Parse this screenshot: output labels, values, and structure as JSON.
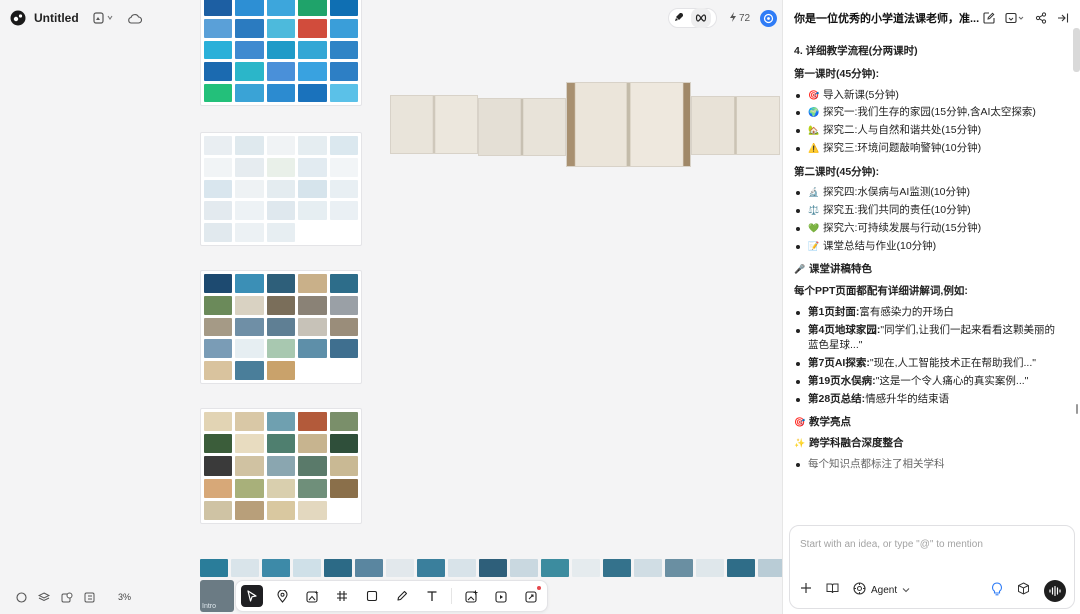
{
  "app": {
    "title": "Untitled"
  },
  "top": {
    "credits": "72",
    "avatar_initial": ""
  },
  "canvas": {
    "zoom": "3%",
    "thumb_caption": "Intro"
  },
  "colors": {
    "board1": [
      "#1d5fa3",
      "#2d8fd4",
      "#3da6dc",
      "#1fa36a",
      "#0f6fb3",
      "#5aa0d8",
      "#2b7bc0",
      "#4dbadc",
      "#d14c3c",
      "#3a9ed9",
      "#2bb0d9",
      "#3f8ad0",
      "#1f9bc8",
      "#34a7d5",
      "#2f84c6",
      "#1b6ab0",
      "#2bb6c9",
      "#4a90d9",
      "#39a2e0",
      "#2d7fc5",
      "#23c07a",
      "#3aa3d6",
      "#2c8bd0",
      "#1a72bc",
      "#5bc1e8"
    ],
    "board2": [
      "#e9eef2",
      "#dfe9ee",
      "#f0f3f5",
      "#e5edf1",
      "#dbe8ef",
      "#f1f4f6",
      "#e6ecf0",
      "#e9f0e9",
      "#e2ebf1",
      "#f2f5f7",
      "#d9e6ee",
      "#eef2f4",
      "#e4ecf0",
      "#d6e4ec",
      "#e8eff3",
      "#e3eaef",
      "#edf2f5",
      "#dfe8ee",
      "#e6eef2",
      "#eaf0f4",
      "#e1e9ee",
      "#ecf1f4",
      "#e7eef2",
      "#ffffff",
      "#ffffff"
    ],
    "board3": [
      "#1d4a70",
      "#3b8fb6",
      "#2e5f7a",
      "#c9b089",
      "#2d6d8a",
      "#6b8a5a",
      "#d9d2c2",
      "#7a6e5a",
      "#8a8276",
      "#9aa0a6",
      "#a59a86",
      "#6f8fa6",
      "#5f7f94",
      "#c7c2b8",
      "#9a8d7a",
      "#7a9cb6",
      "#e6eef2",
      "#a8c8b0",
      "#5e8fa9",
      "#3f6f8f",
      "#d9c39e",
      "#4a7e9a",
      "#c9a26b",
      "#ffffff",
      "#ffffff"
    ],
    "board4": [
      "#e2d4b4",
      "#d9c8a6",
      "#6fa0b0",
      "#b35a3a",
      "#7a8f6a",
      "#3b5d3a",
      "#e8dcc0",
      "#4f7f6f",
      "#c7b48f",
      "#2f4f3a",
      "#3a3a3a",
      "#d0c2a2",
      "#8aa6b0",
      "#5a7a6a",
      "#c9b994",
      "#d7a878",
      "#a8b07a",
      "#d9cfae",
      "#6f8f7a",
      "#8a6f4a",
      "#cfc3a4",
      "#b89f7a",
      "#d9c8a0",
      "#e3d8bf",
      "#ffffff"
    ],
    "strip": [
      "#2a7d9a",
      "#d9e4ea",
      "#3d8aa8",
      "#cfe0e8",
      "#2c6a86",
      "#5a86a0",
      "#e2e8ec",
      "#3a7f9c",
      "#d8e3e9",
      "#2e5f7a",
      "#c9d8e0",
      "#3c8c9f",
      "#e5ebee",
      "#34728c",
      "#d0dde4",
      "#6a8fa2",
      "#dfe7eb",
      "#2f6d88",
      "#b9ccd6",
      "#4c8aa6",
      "#dde5ea",
      "#36809c",
      "#cfdde4",
      "#5a7f93",
      "#2a6f8c",
      "#e3e9ec"
    ]
  },
  "panel": {
    "title": "你是一位优秀的小学道法课老师，准...",
    "section_flow": "4. 详细教学流程(分两课时)",
    "lesson1_title": "第一课时(45分钟):",
    "lesson1_items": [
      {
        "icon": "🎯",
        "text": "导入新课(5分钟)"
      },
      {
        "icon": "🌍",
        "text": "探究一:我们生存的家园(15分钟,含AI太空探索)"
      },
      {
        "icon": "🏡",
        "text": "探究二:人与自然和谐共处(15分钟)"
      },
      {
        "icon": "⚠️",
        "text": "探究三:环境问题敲响警钟(10分钟)"
      }
    ],
    "lesson2_title": "第二课时(45分钟):",
    "lesson2_items": [
      {
        "icon": "🔬",
        "text": "探究四:水俣病与AI监测(10分钟)"
      },
      {
        "icon": "⚖️",
        "text": "探究五:我们共同的责任(10分钟)"
      },
      {
        "icon": "💚",
        "text": "探究六:可持续发展与行动(15分钟)"
      },
      {
        "icon": "📝",
        "text": "课堂总结与作业(10分钟)"
      }
    ],
    "speech_icon": "🎤",
    "speech_title": "课堂讲稿特色",
    "speech_intro": "每个PPT页面都配有详细讲解词,例如:",
    "speech_items": [
      {
        "label": "第1页封面:",
        "text": "富有感染力的开场白"
      },
      {
        "label": "第4页地球家园:",
        "text": "\"同学们,让我们一起来看看这颗美丽的蓝色星球...\""
      },
      {
        "label": "第7页AI探索:",
        "text": "\"现在,人工智能技术正在帮助我们...\""
      },
      {
        "label": "第19页水俣病:",
        "text": "\"这是一个令人痛心的真实案例...\""
      },
      {
        "label": "第28页总结:",
        "text": "情感升华的结束语"
      }
    ],
    "highlights_icon": "🎯",
    "highlights_title": "教学亮点",
    "cross_icon": "✨",
    "cross_title": "跨学科融合深度整合",
    "cross_item": "每个知识点都标注了相关学科"
  },
  "composer": {
    "placeholder": "Start with an idea, or type \"@\" to mention",
    "agent_label": "Agent"
  }
}
